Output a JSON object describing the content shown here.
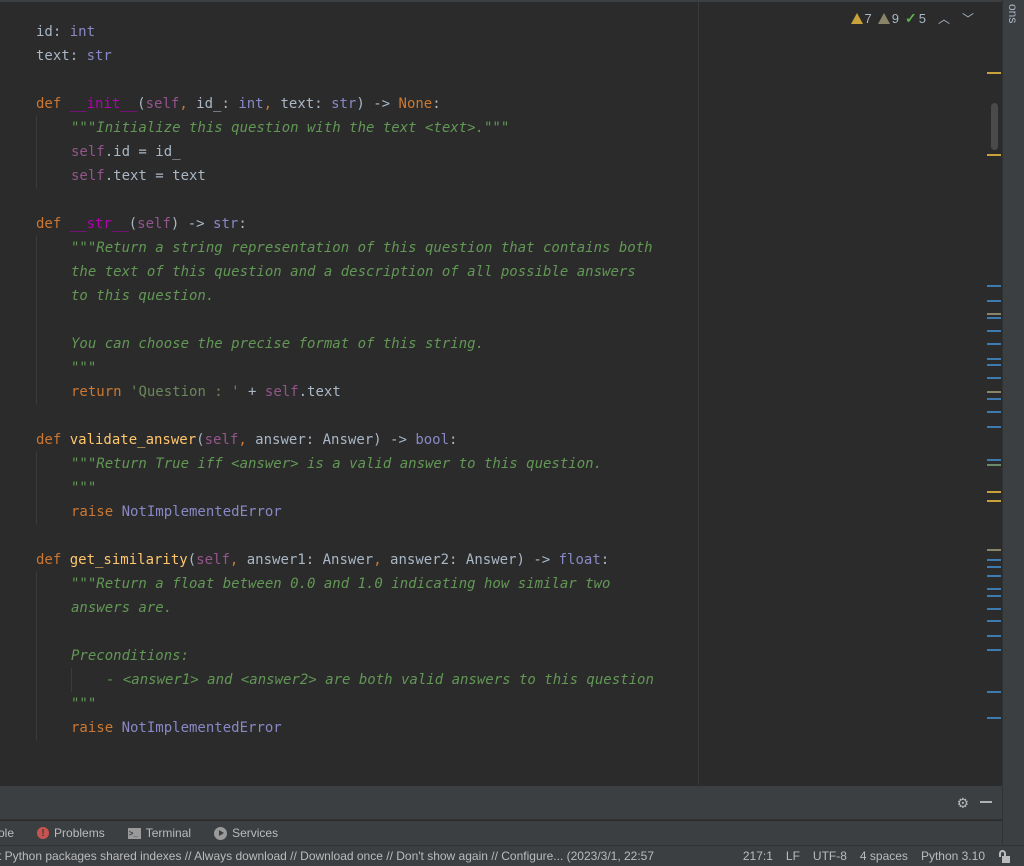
{
  "editor": {
    "top_fragment": "\"\"\"",
    "lines": {
      "l_id": [
        "id",
        ": ",
        "int"
      ],
      "l_text": [
        "text",
        ": ",
        "str"
      ],
      "init_def": [
        "def ",
        "__init__",
        "(",
        "self",
        ", ",
        "id_",
        ": ",
        "int",
        ", ",
        "text",
        ": ",
        "str",
        ") -> ",
        "None",
        ":"
      ],
      "init_doc": "\"\"\"Initialize this question with the text <text>.\"\"\"",
      "init_l1": [
        "self",
        ".id = id_"
      ],
      "init_l2": [
        "self",
        ".text = text"
      ],
      "str_def": [
        "def ",
        "__str__",
        "(",
        "self",
        ") -> ",
        "str",
        ":"
      ],
      "str_doc1": "\"\"\"Return a string representation of this question that contains both",
      "str_doc2": "the text of this question and a description of all possible answers",
      "str_doc3": "to this question.",
      "str_doc4": "You can choose the precise format of this string.",
      "str_doc5": "\"\"\"",
      "str_ret": [
        "return ",
        "'Question : '",
        " + ",
        "self",
        ".text"
      ],
      "va_def": [
        "def ",
        "validate_answer",
        "(",
        "self",
        ", ",
        "answer: Answer) -> ",
        "bool",
        ":"
      ],
      "va_doc1": "\"\"\"Return True iff <answer> is a valid answer to this question.",
      "va_doc2": "\"\"\"",
      "va_raise": [
        "raise ",
        "NotImplementedError"
      ],
      "gs_def": [
        "def ",
        "get_similarity",
        "(",
        "self",
        ", ",
        "answer1: Answer",
        ", ",
        "answer2: Answer) -> ",
        "float",
        ":"
      ],
      "gs_doc1": "\"\"\"Return a float between 0.0 and 1.0 indicating how similar two",
      "gs_doc2": "answers are.",
      "gs_doc3": "Preconditions:",
      "gs_doc4": "- <answer1> and <answer2> are both valid answers to this question",
      "gs_doc5": "\"\"\"",
      "gs_raise": [
        "raise ",
        "NotImplementedError"
      ]
    }
  },
  "inspections": {
    "warnings": "7",
    "weak_warnings": "9",
    "typos": "5",
    "prev_icon": "chevron-up-icon",
    "next_icon": "chevron-down-icon"
  },
  "side_panel": {
    "label": "ons"
  },
  "tool_window": {
    "settings_icon": "gear-icon",
    "hide_icon": "minimize-icon"
  },
  "tool_tabs": [
    {
      "label": "ole",
      "icon": ""
    },
    {
      "label": "Problems",
      "icon": "error-icon"
    },
    {
      "label": "Terminal",
      "icon": "terminal-icon"
    },
    {
      "label": "Services",
      "icon": "services-icon"
    }
  ],
  "status_bar": {
    "message": "t Python packages shared indexes // Always download // Download once // Don't show again // Configure... (2023/3/1, 22:57",
    "position": "217:1",
    "line_ending": "LF",
    "encoding": "UTF-8",
    "indent": "4 spaces",
    "interpreter": "Python 3.10",
    "lock_icon": "unlocked-icon"
  },
  "colors": {
    "keyword": "#cc7832",
    "docstring": "#629755",
    "self": "#94558d",
    "builtin_type": "#8888c6",
    "function": "#ffc66d",
    "magic_function": "#b200b2",
    "warning": "#c9a23b",
    "error": "#c75450"
  }
}
